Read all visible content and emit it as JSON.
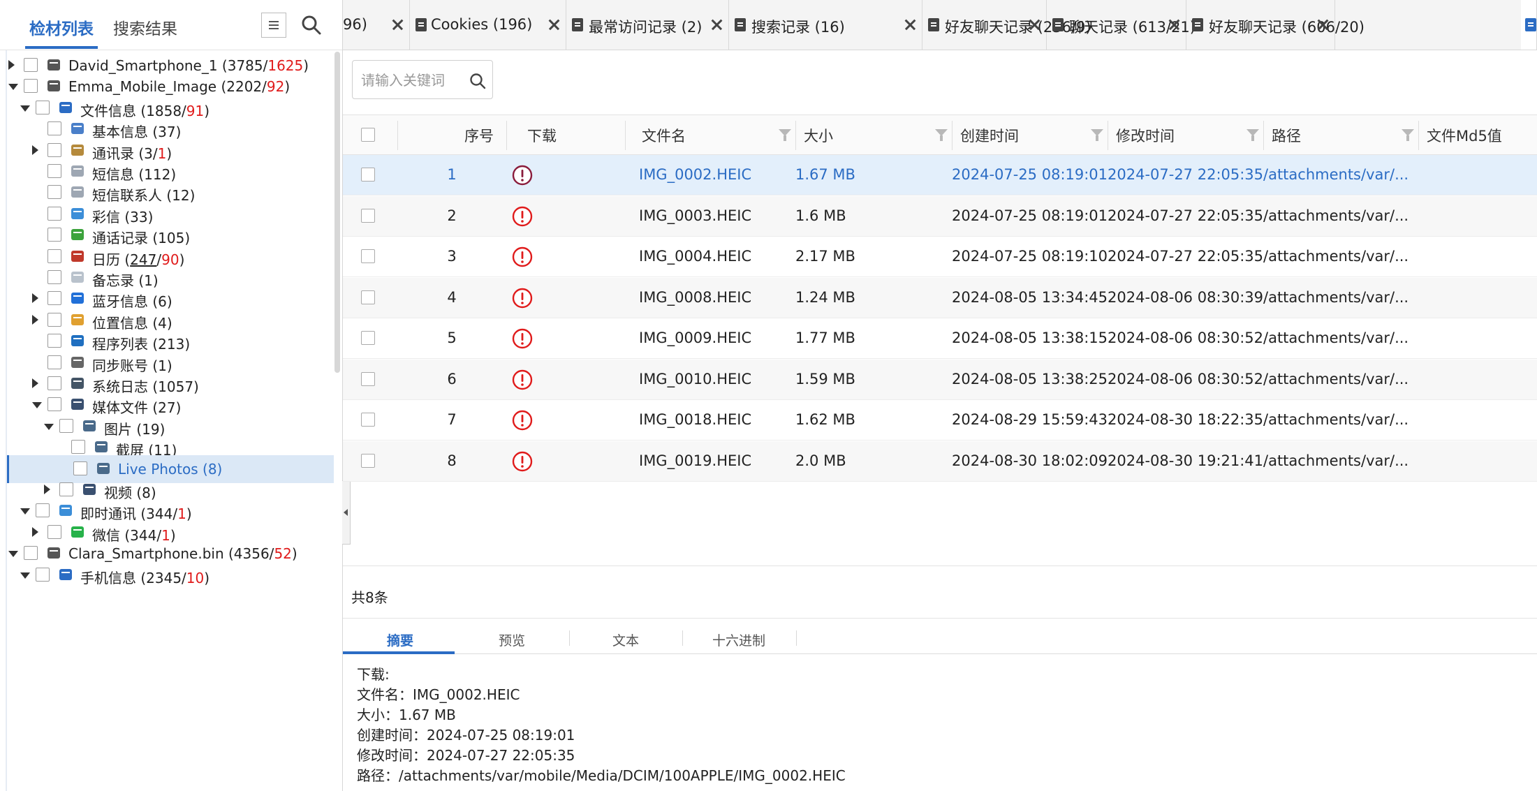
{
  "left_panel": {
    "tab_active": "检材列表",
    "tab_inactive": "搜索结果",
    "icons": {
      "menu": "menu-icon",
      "search": "search-icon"
    },
    "tree": [
      {
        "label": "David_Smartphone_1 (3785/",
        "red": "1625",
        "tail": ")",
        "icon": "disk-icon",
        "expand": "right"
      },
      {
        "label": "Emma_Mobile_Image (2202/",
        "red": "92",
        "tail": ")",
        "icon": "disk-icon",
        "expand": "down"
      },
      {
        "label": "文件信息 (1858/",
        "red": "91",
        "tail": ")",
        "icon": "phone-icon",
        "expand": "down"
      },
      {
        "label": "基本信息 (37)",
        "icon": "id-card-icon",
        "expand": "none"
      },
      {
        "label": "通讯录 (3/",
        "red": "1",
        "tail": ")",
        "icon": "contacts-icon",
        "expand": "right"
      },
      {
        "label": "短信息 (112)",
        "icon": "mail-icon",
        "expand": "none"
      },
      {
        "label": "短信联系人 (12)",
        "icon": "mail-icon",
        "expand": "none"
      },
      {
        "label": "彩信 (33)",
        "icon": "chat-bubbles-icon",
        "expand": "none"
      },
      {
        "label": "通话记录 (105)",
        "icon": "phone-call-icon",
        "expand": "none"
      },
      {
        "label": "日历 (",
        "link": "247",
        "mid": "/",
        "red": "90",
        "tail": ")",
        "icon": "calendar-icon",
        "expand": "none"
      },
      {
        "label": "备忘录 (1)",
        "icon": "note-icon",
        "expand": "none"
      },
      {
        "label": "蓝牙信息 (6)",
        "icon": "bluetooth-icon",
        "expand": "right"
      },
      {
        "label": "位置信息 (4)",
        "icon": "map-icon",
        "expand": "right"
      },
      {
        "label": "程序列表 (213)",
        "icon": "app-list-icon",
        "expand": "none"
      },
      {
        "label": "同步账号 (1)",
        "icon": "user-account-icon",
        "expand": "none"
      },
      {
        "label": "系统日志 (1057)",
        "icon": "system-log-icon",
        "expand": "right"
      },
      {
        "label": "媒体文件 (27)",
        "icon": "film-icon",
        "expand": "down"
      },
      {
        "label": "图片 (19)",
        "icon": "picture-icon",
        "expand": "down"
      },
      {
        "label": "截屏 (11)",
        "icon": "picture-icon",
        "expand": "none"
      },
      {
        "label": "Live Photos (8)",
        "icon": "picture-icon",
        "expand": "none",
        "selected": true
      },
      {
        "label": "视频 (8)",
        "icon": "film-icon",
        "expand": "right"
      },
      {
        "label": "即时通讯 (344/",
        "red": "1",
        "tail": ")",
        "icon": "chat-bubbles-icon",
        "expand": "down"
      },
      {
        "label": "微信 (344/",
        "red": "1",
        "tail": ")",
        "icon": "wechat-icon",
        "expand": "right"
      },
      {
        "label": "Clara_Smartphone.bin (4356/",
        "red": "52",
        "tail": ")",
        "icon": "disk-icon",
        "expand": "down"
      },
      {
        "label": "手机信息 (2345/",
        "red": "10",
        "tail": ")",
        "icon": "phone-icon",
        "expand": "down"
      }
    ]
  },
  "doc_tabs": [
    {
      "label": "96)"
    },
    {
      "label": "Cookies (196)"
    },
    {
      "label": "最常访问记录 (2)"
    },
    {
      "label": "搜索记录 (16)"
    },
    {
      "label": "好友聊天记录 (256/9)"
    },
    {
      "label": "聊天记录 (613/21)"
    },
    {
      "label": "好友聊天记录 (606/20)"
    }
  ],
  "search": {
    "placeholder": "请输入关键词"
  },
  "table": {
    "headers": [
      "序号",
      "下载",
      "文件名",
      "大小",
      "创建时间",
      "修改时间",
      "路径",
      "文件Md5值"
    ],
    "rows": [
      {
        "no": "1",
        "name": "IMG_0002.HEIC",
        "size": "1.67 MB",
        "created": "2024-07-25 08:19:01",
        "modified": "2024-07-27 22:05:35",
        "path": "/attachments/var/...",
        "selected": true
      },
      {
        "no": "2",
        "name": "IMG_0003.HEIC",
        "size": "1.6 MB",
        "created": "2024-07-25 08:19:01",
        "modified": "2024-07-27 22:05:35",
        "path": "/attachments/var/..."
      },
      {
        "no": "3",
        "name": "IMG_0004.HEIC",
        "size": "2.17 MB",
        "created": "2024-07-25 08:19:10",
        "modified": "2024-07-27 22:05:35",
        "path": "/attachments/var/..."
      },
      {
        "no": "4",
        "name": "IMG_0008.HEIC",
        "size": "1.24 MB",
        "created": "2024-08-05 13:34:45",
        "modified": "2024-08-06 08:30:39",
        "path": "/attachments/var/..."
      },
      {
        "no": "5",
        "name": "IMG_0009.HEIC",
        "size": "1.77 MB",
        "created": "2024-08-05 13:38:15",
        "modified": "2024-08-06 08:30:52",
        "path": "/attachments/var/..."
      },
      {
        "no": "6",
        "name": "IMG_0010.HEIC",
        "size": "1.59 MB",
        "created": "2024-08-05 13:38:25",
        "modified": "2024-08-06 08:30:52",
        "path": "/attachments/var/..."
      },
      {
        "no": "7",
        "name": "IMG_0018.HEIC",
        "size": "1.62 MB",
        "created": "2024-08-29 15:59:43",
        "modified": "2024-08-30 18:22:35",
        "path": "/attachments/var/..."
      },
      {
        "no": "8",
        "name": "IMG_0019.HEIC",
        "size": "2.0 MB",
        "created": "2024-08-30 18:02:09",
        "modified": "2024-08-30 19:21:41",
        "path": "/attachments/var/..."
      }
    ],
    "total": "共8条"
  },
  "detail_tabs": [
    "摘要",
    "预览",
    "文本",
    "十六进制"
  ],
  "details": [
    "下载:",
    "文件名：IMG_0002.HEIC",
    "大小：1.67 MB",
    "创建时间：2024-07-25 08:19:01",
    "修改时间：2024-07-27 22:05:35",
    "路径：/attachments/var/mobile/Media/DCIM/100APPLE/IMG_0002.HEIC"
  ],
  "colors": {
    "accent": "#2b6cc4",
    "red": "#e01b1b",
    "selected_row": "#e3effb",
    "selected_node": "#dbe8f6"
  }
}
